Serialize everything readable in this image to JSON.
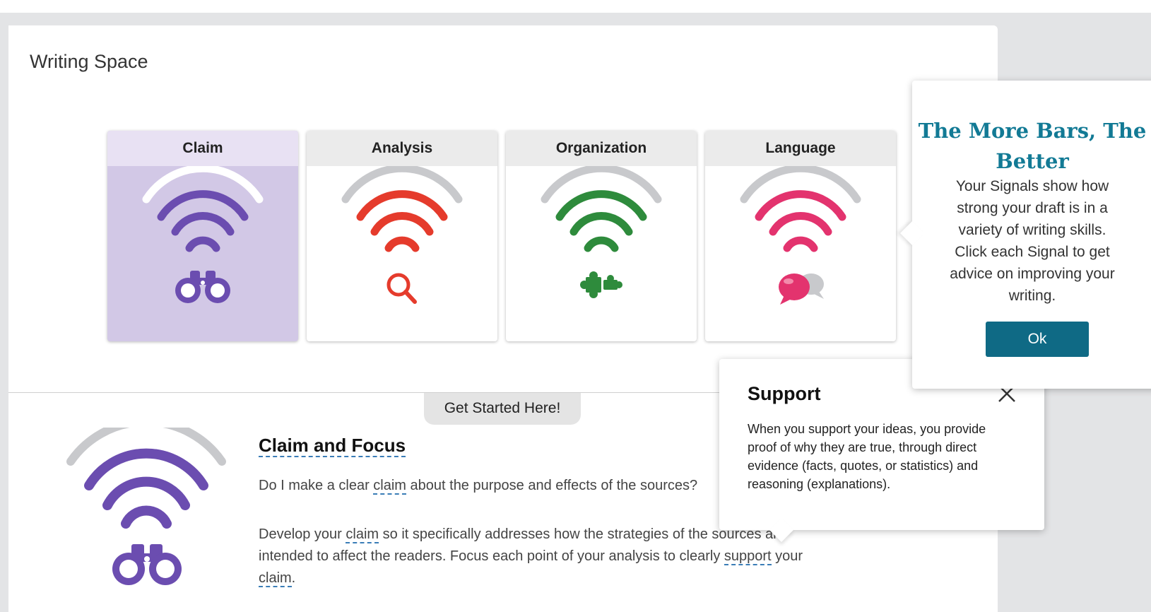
{
  "app": {
    "title": "Writing Space"
  },
  "signals": [
    {
      "label": "Claim",
      "color": "#6b4db0",
      "icon": "binoculars-icon",
      "active": true
    },
    {
      "label": "Analysis",
      "color": "#e53b2c",
      "icon": "magnifier-icon",
      "active": false
    },
    {
      "label": "Organization",
      "color": "#2e8b3c",
      "icon": "puzzle-icon",
      "active": false
    },
    {
      "label": "Language",
      "color": "#e3336e",
      "icon": "speech-bubbles-icon",
      "active": false
    }
  ],
  "get_started": {
    "label": "Get Started Here!"
  },
  "detail": {
    "title": "Claim and Focus",
    "question_before": "Do I make a clear ",
    "question_term": "claim",
    "question_after": " about the purpose and effects of the sources?",
    "body_before": "Develop your ",
    "body_term1": "claim",
    "body_mid": " so it specifically addresses how the strategies of the sources are intended to affect the readers. Focus each point of your analysis to clearly ",
    "body_term2": "support",
    "body_after": " your ",
    "body_term3": "claim",
    "body_end": "."
  },
  "support_popover": {
    "title": "Support",
    "body": "When you support your ideas, you provide proof of why they are true, through direct evidence (facts, quotes, or statistics) and reasoning (explanations)."
  },
  "tip_popover": {
    "title": "The More Bars, The Better",
    "body": "Your Signals show how strong your draft is in a variety of writing skills. Click each Signal to get advice on improving your writing.",
    "ok_label": "Ok"
  },
  "colors": {
    "teal_title": "#127a95",
    "ok_button": "#0f6a85",
    "inactive_bar": "#c8c9cc",
    "claim_card_bg": "#d2c8e6"
  }
}
